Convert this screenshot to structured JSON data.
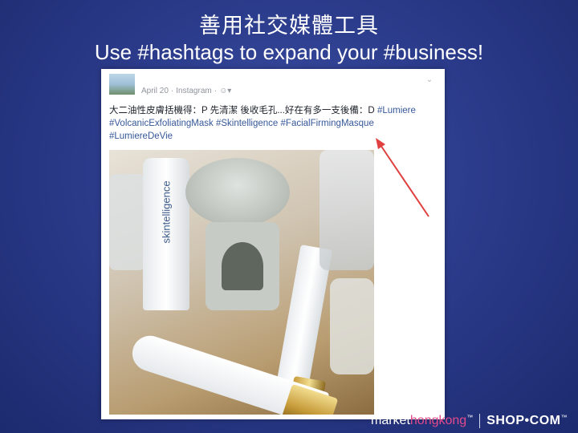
{
  "slide": {
    "title": "善用社交媒體工具",
    "subtitle": "Use #hashtags to expand your #business!"
  },
  "post": {
    "date": "April 20",
    "source": "Instagram",
    "separator": "·",
    "caption_text": "大二油性皮膚括機得：P 先清潔 後收毛孔...好在有多一支後備：D ",
    "hashtags": [
      "#Lumiere",
      "#VolcanicExfoliatingMask",
      "#Skintelligence",
      "#FacialFirmingMasque",
      "#LumiereDeVie"
    ],
    "photo_label": "skintelligence"
  },
  "branding": {
    "market_text": "market",
    "hongkong_text": "hongkong",
    "tm": "™",
    "shop_text": "SHOP•COM",
    "shop_tm": "™"
  },
  "colors": {
    "background": "#2c3c8c",
    "hashtag": "#365899",
    "arrow": "#e04040",
    "hongkong": "#e34a8c"
  }
}
